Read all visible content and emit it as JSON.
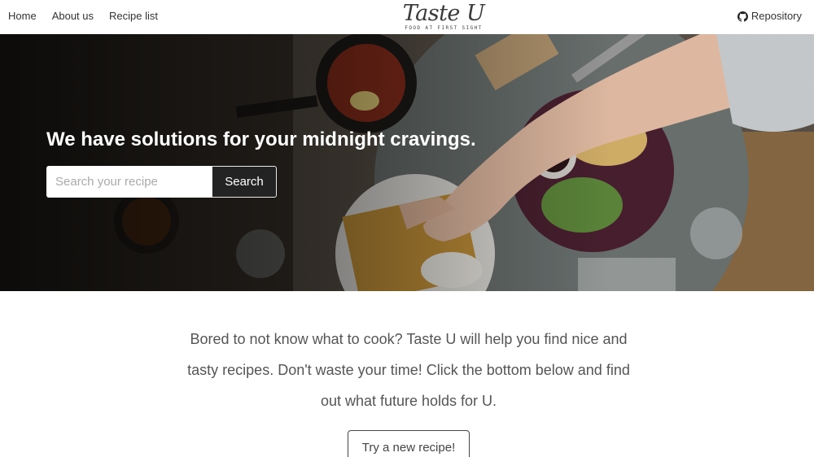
{
  "navbar": {
    "links": [
      {
        "label": "Home"
      },
      {
        "label": "About us"
      },
      {
        "label": "Recipe list"
      }
    ],
    "brand": {
      "title": "Taste U",
      "tagline": "FOOD AT FIRST SIGHT"
    },
    "repo": {
      "label": "Repository",
      "icon": "github-icon"
    }
  },
  "hero": {
    "title": "We have solutions for your midnight cravings.",
    "search": {
      "placeholder": "Search your recipe",
      "value": "",
      "button_label": "Search"
    }
  },
  "intro": {
    "text": "Bored to not know what to cook? Taste U will help you find nice and tasty recipes. Don't waste your time! Click the bottom below and find out what future holds for U."
  },
  "cta": {
    "label": "Try a new recipe!"
  },
  "colors": {
    "accent": "#232323",
    "text": "#555555"
  }
}
